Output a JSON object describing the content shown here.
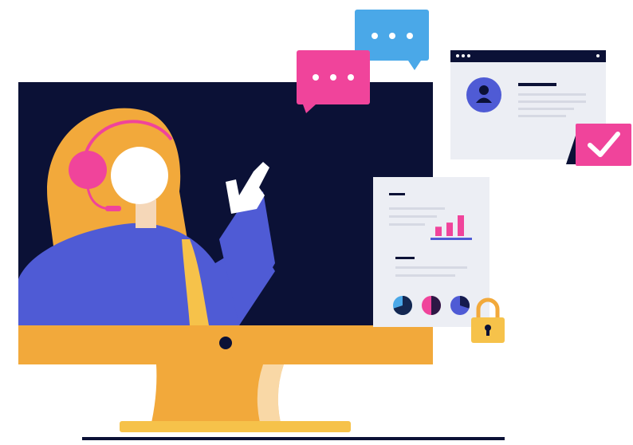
{
  "colors": {
    "navy": "#0b1136",
    "gold": "#f2a93b",
    "gold_light": "#f6c24a",
    "blue": "#4f5bd5",
    "pink": "#f0449b",
    "sky": "#4aa8e8",
    "paper": "#eceef4",
    "white": "#ffffff"
  },
  "illustration": {
    "subject": "customer-support-agent-on-monitor",
    "icons": [
      "headset-icon",
      "speech-bubble-icon",
      "profile-card-icon",
      "checkmark-icon",
      "report-document-icon",
      "bar-chart-icon",
      "pie-chart-icon",
      "padlock-icon"
    ]
  },
  "report_chart": {
    "bar_levels": [
      0.45,
      0.65,
      1.0
    ],
    "pie_fractions": [
      0.7,
      0.5,
      0.3
    ]
  }
}
